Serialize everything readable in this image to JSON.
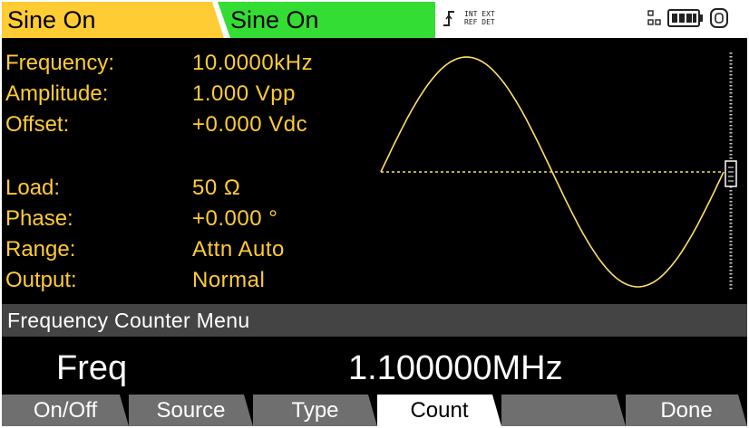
{
  "colors": {
    "ch1": "#ffcc33",
    "ch2": "#33dd33",
    "param_text": "#ffcc33",
    "waveform": "#ffe066",
    "selected_softkey": "#ffffff"
  },
  "topbar": {
    "ch1_label": "Sine On",
    "ch2_label": "Sine On",
    "trigger_text": "INT EXT\nREF DET",
    "icons": [
      "trigger-edge-icon",
      "grid-icon",
      "battery-icon",
      "lock-icon"
    ]
  },
  "params": [
    {
      "label": "Frequency:",
      "value": "10.0000kHz"
    },
    {
      "label": "Amplitude:",
      "value": "1.000  Vpp"
    },
    {
      "label": "Offset:",
      "value": "+0.000  Vdc"
    },
    {
      "label": "Load:",
      "value": "50  Ω"
    },
    {
      "label": "Phase:",
      "value": "+0.000 °"
    },
    {
      "label": "Range:",
      "value": "Attn  Auto"
    },
    {
      "label": "Output:",
      "value": "Normal"
    }
  ],
  "waveform": {
    "type": "sine",
    "cycles": 1,
    "baseline": "dashed"
  },
  "menu": {
    "title": "Frequency Counter Menu",
    "edit_label": "Freq",
    "edit_value": "1.100000MHz"
  },
  "softkeys": [
    {
      "label": "On/Off",
      "selected": false
    },
    {
      "label": "Source",
      "selected": false
    },
    {
      "label": "Type",
      "selected": false
    },
    {
      "label": "Count",
      "selected": true
    },
    {
      "label": "",
      "selected": false
    },
    {
      "label": "Done",
      "selected": false
    }
  ]
}
